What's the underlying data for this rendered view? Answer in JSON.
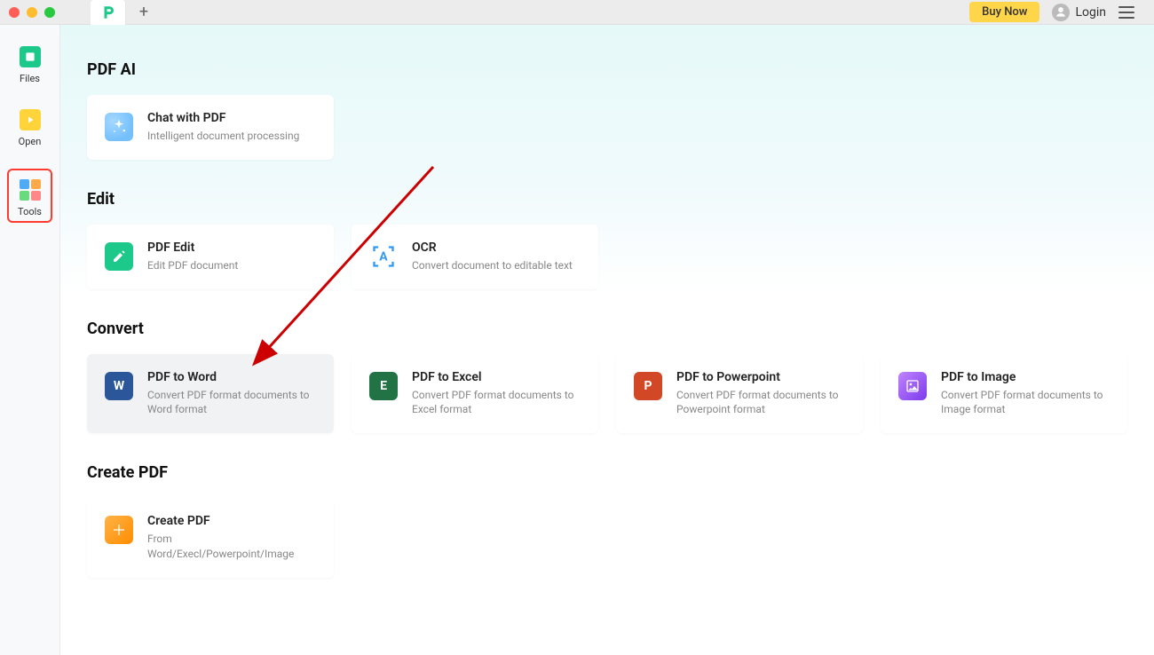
{
  "titlebar": {
    "buy_now": "Buy Now",
    "login": "Login"
  },
  "sidebar": {
    "files": "Files",
    "open": "Open",
    "tools": "Tools"
  },
  "sections": {
    "pdf_ai": {
      "title": "PDF AI",
      "items": [
        {
          "title": "Chat with PDF",
          "desc": "Intelligent document processing"
        }
      ]
    },
    "edit": {
      "title": "Edit",
      "items": [
        {
          "title": "PDF Edit",
          "desc": "Edit PDF document"
        },
        {
          "title": "OCR",
          "desc": "Convert document to editable text"
        }
      ]
    },
    "convert": {
      "title": "Convert",
      "items": [
        {
          "title": "PDF to Word",
          "desc": "Convert PDF format documents to Word format"
        },
        {
          "title": "PDF to Excel",
          "desc": "Convert PDF format documents to Excel format"
        },
        {
          "title": "PDF to Powerpoint",
          "desc": "Convert PDF format documents to Powerpoint format"
        },
        {
          "title": "PDF to Image",
          "desc": "Convert PDF format documents to Image format"
        }
      ]
    },
    "create": {
      "title": "Create PDF",
      "items": [
        {
          "title": "Create PDF",
          "desc": "From Word/Execl/Powerpoint/Image"
        }
      ]
    }
  },
  "annotation": {
    "highlighted_sidebar": "tools",
    "arrow_target": "pdf-to-word"
  }
}
